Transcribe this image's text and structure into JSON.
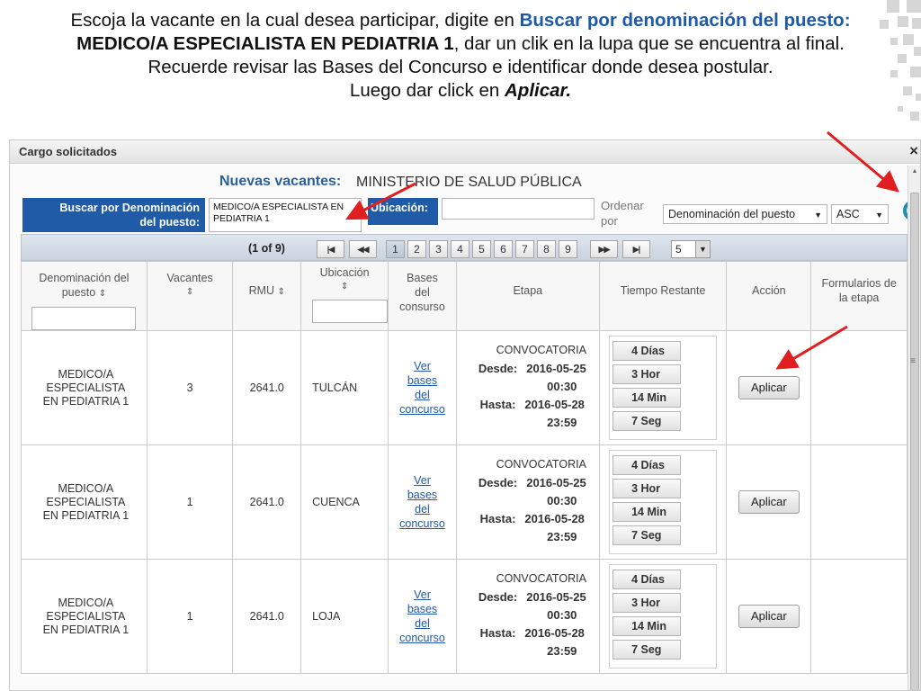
{
  "instructions": {
    "l1_a": "Escoja la vacante en la cual desea participar, digite en ",
    "l1_hl": "Buscar por denominación del puesto:",
    "l2_b": "MEDICO/A ESPECIALISTA EN PEDIATRIA 1",
    "l2_rest": ", dar un clik en la lupa que se encuentra al final.",
    "l3": "Recuerde revisar las Bases del Concurso e identificar donde desea postular.",
    "l4_a": "Luego dar click en ",
    "l4_i": "Aplicar."
  },
  "dialog": {
    "title": "Cargo solicitados",
    "close": "×"
  },
  "filters": {
    "nuevas_label": "Nuevas vacantes:",
    "ministerio": "MINISTERIO DE SALUD PÚBLICA",
    "denom_label_1": "Buscar por Denominación",
    "denom_label_2": "del puesto:",
    "denom_value_1": "MEDICO/A ESPECIALISTA EN",
    "denom_value_2": "PEDIATRIA 1",
    "ubic_label": "Ubicación:",
    "ubic_value": "",
    "ordenar_1": "Ordenar",
    "ordenar_2": "por",
    "order_field": "Denominación del puesto",
    "order_dir": "ASC",
    "search_icon": "magnifier-icon"
  },
  "pager": {
    "count": "(1 of 9)",
    "first": "|◀",
    "prev": "◀◀",
    "pages": [
      "1",
      "2",
      "3",
      "4",
      "5",
      "6",
      "7",
      "8",
      "9"
    ],
    "current_page": "1",
    "next": "▶▶",
    "last": "▶|",
    "page_size": "5"
  },
  "table": {
    "headers": {
      "denom_1": "Denominación del",
      "denom_2": "puesto",
      "vacantes": "Vacantes",
      "rmu": "RMU",
      "ubicacion": "Ubicación",
      "bases_1": "Bases",
      "bases_2": "del",
      "bases_3": "consurso",
      "etapa": "Etapa",
      "tiempo": "Tiempo Restante",
      "accion": "Acción",
      "form_1": "Formularios de",
      "form_2": "la etapa"
    },
    "rows": [
      {
        "name_1": "MEDICO/A ESPECIALISTA",
        "name_2": "EN PEDIATRIA 1",
        "vacantes": "3",
        "rmu": "2641.0",
        "ubicacion": "TULCÁN",
        "link": [
          "Ver",
          "bases",
          "del",
          "concurso"
        ],
        "etapa": "CONVOCATORIA",
        "desde_label": "Desde:",
        "desde_date": "2016-05-25",
        "desde_time": "00:30",
        "hasta_label": "Hasta:",
        "hasta_date": "2016-05-28",
        "hasta_time": "23:59",
        "timer": [
          "4 Días",
          "3 Hor",
          "14 Min",
          "7 Seg"
        ],
        "action": "Aplicar"
      },
      {
        "name_1": "MEDICO/A ESPECIALISTA",
        "name_2": "EN PEDIATRIA 1",
        "vacantes": "1",
        "rmu": "2641.0",
        "ubicacion": "CUENCA",
        "link": [
          "Ver",
          "bases",
          "del",
          "concurso"
        ],
        "etapa": "CONVOCATORIA",
        "desde_label": "Desde:",
        "desde_date": "2016-05-25",
        "desde_time": "00:30",
        "hasta_label": "Hasta:",
        "hasta_date": "2016-05-28",
        "hasta_time": "23:59",
        "timer": [
          "4 Días",
          "3 Hor",
          "14 Min",
          "7 Seg"
        ],
        "action": "Aplicar"
      },
      {
        "name_1": "MEDICO/A ESPECIALISTA",
        "name_2": "EN PEDIATRIA 1",
        "vacantes": "1",
        "rmu": "2641.0",
        "ubicacion": "LOJA",
        "link": [
          "Ver",
          "bases",
          "del",
          "concurso"
        ],
        "etapa": "CONVOCATORIA",
        "desde_label": "Desde:",
        "desde_date": "2016-05-25",
        "desde_time": "00:30",
        "hasta_label": "Hasta:",
        "hasta_date": "2016-05-28",
        "hasta_time": "23:59",
        "timer": [
          "4 Días",
          "3 Hor",
          "14 Min",
          "7 Seg"
        ],
        "action": "Aplicar"
      }
    ]
  },
  "colors": {
    "accent_blue": "#1f5ba6",
    "arrow_red": "#e02020"
  }
}
